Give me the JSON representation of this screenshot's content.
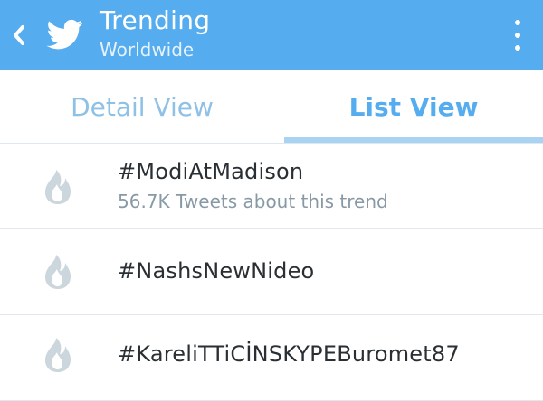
{
  "header": {
    "title": "Trending",
    "subtitle": "Worldwide",
    "accent_color": "#55acee",
    "back_icon": "chevron-left-icon",
    "logo_icon": "twitter-bird-icon",
    "menu_icon": "overflow-menu-icon"
  },
  "tabs": [
    {
      "label": "Detail View",
      "active": false
    },
    {
      "label": "List View",
      "active": true
    }
  ],
  "trends": [
    {
      "name": "#ModiAtMadison",
      "meta": "56.7K Tweets about this trend",
      "icon": "flame-icon"
    },
    {
      "name": "#NashsNewNideo",
      "meta": "",
      "icon": "flame-icon"
    },
    {
      "name": "#KareliTTiCİNSKYPEBuromet87",
      "meta": "",
      "icon": "flame-icon"
    }
  ]
}
